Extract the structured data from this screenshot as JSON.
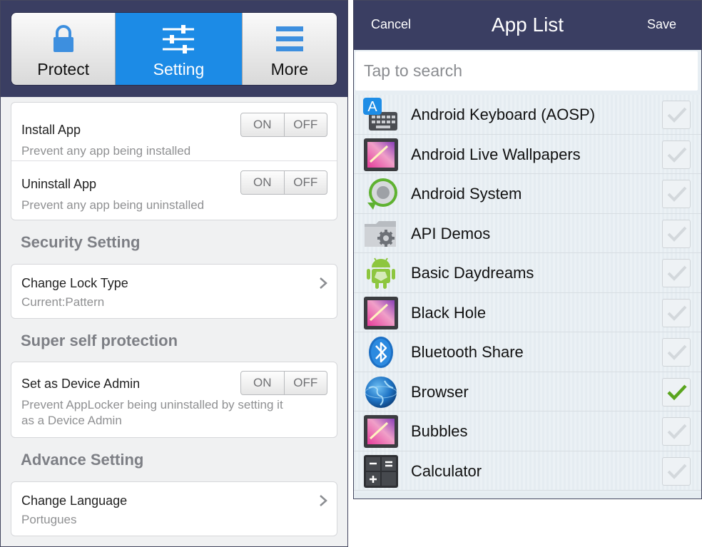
{
  "left": {
    "tabs": [
      {
        "label": "Protect",
        "icon": "lock-icon",
        "active": false
      },
      {
        "label": "Setting",
        "icon": "sliders-icon",
        "active": true
      },
      {
        "label": "More",
        "icon": "menu-icon",
        "active": false
      }
    ],
    "install": {
      "title": "Install App",
      "subtitle": "Prevent any app being installed",
      "on": "ON",
      "off": "OFF"
    },
    "uninstall": {
      "title": "Uninstall App",
      "subtitle": "Prevent any app being uninstalled",
      "on": "ON",
      "off": "OFF"
    },
    "security_section": "Security Setting",
    "lock_type": {
      "title": "Change Lock Type",
      "value": "Current:Pattern"
    },
    "self_protection_section": "Super self protection",
    "device_admin": {
      "title": "Set as Device Admin",
      "subtitle_line1": "Prevent AppLocker being uninstalled by setting it",
      "subtitle_line2": "as a Device Admin",
      "on": "ON",
      "off": "OFF"
    },
    "advance_section": "Advance Setting",
    "language": {
      "title": "Change Language",
      "value": "Portugues"
    }
  },
  "right": {
    "cancel": "Cancel",
    "title": "App List",
    "save": "Save",
    "search_placeholder": "Tap to search",
    "apps": [
      {
        "name": "Android Keyboard (AOSP)",
        "icon": "keyboard-icon",
        "checked": false
      },
      {
        "name": "Android Live Wallpapers",
        "icon": "gallery-icon",
        "checked": false
      },
      {
        "name": "Android System",
        "icon": "android-system-icon",
        "checked": false
      },
      {
        "name": "API Demos",
        "icon": "folder-gear-icon",
        "checked": false
      },
      {
        "name": "Basic Daydreams",
        "icon": "android-robot-icon",
        "checked": false
      },
      {
        "name": "Black Hole",
        "icon": "gallery-icon",
        "checked": false
      },
      {
        "name": "Bluetooth Share",
        "icon": "bluetooth-icon",
        "checked": false
      },
      {
        "name": "Browser",
        "icon": "globe-icon",
        "checked": true
      },
      {
        "name": "Bubbles",
        "icon": "gallery-icon",
        "checked": false
      },
      {
        "name": "Calculator",
        "icon": "calculator-icon",
        "checked": false
      }
    ]
  },
  "colors": {
    "header": "#3a3e62",
    "accent": "#1c8be6",
    "check": "#5aa51e"
  }
}
